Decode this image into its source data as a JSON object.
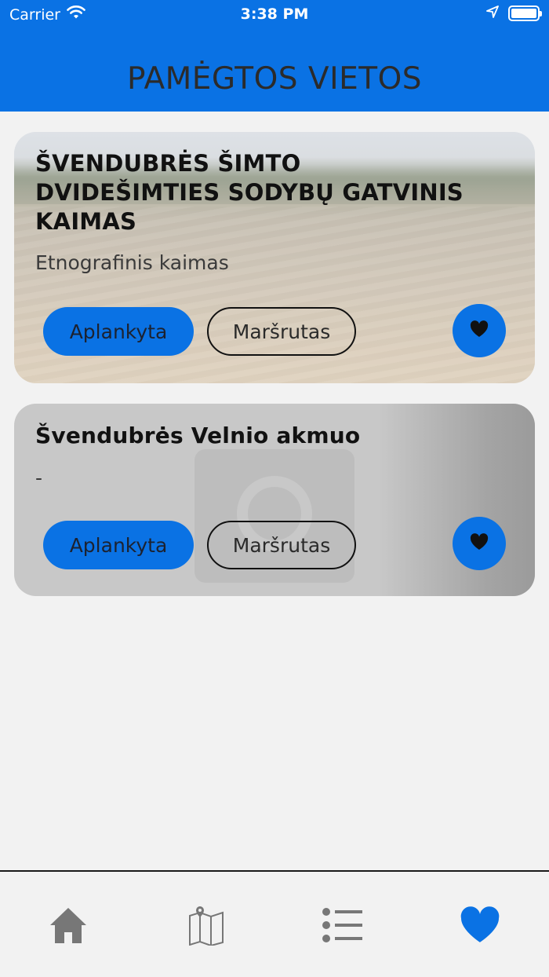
{
  "status_bar": {
    "carrier": "Carrier",
    "time": "3:38 PM"
  },
  "header": {
    "title": "PAMĖGTOS VIETOS"
  },
  "places": [
    {
      "title": "ŠVENDUBRĖS ŠIMTO DVIDEŠIMTIES SODYBŲ GATVINIS KAIMAS",
      "subtitle": "Etnografinis kaimas",
      "visited_label": "Aplankyta",
      "route_label": "Maršrutas"
    },
    {
      "title": "Švendubrės Velnio akmuo",
      "subtitle": "-",
      "visited_label": "Aplankyta",
      "route_label": "Maršrutas"
    }
  ],
  "tabbar": {
    "items": [
      "home-icon",
      "map-icon",
      "list-icon",
      "heart-icon"
    ],
    "active": "heart-icon"
  },
  "colors": {
    "accent": "#0a72e4",
    "background": "#f2f2f2",
    "inactive_icon": "#777777"
  }
}
